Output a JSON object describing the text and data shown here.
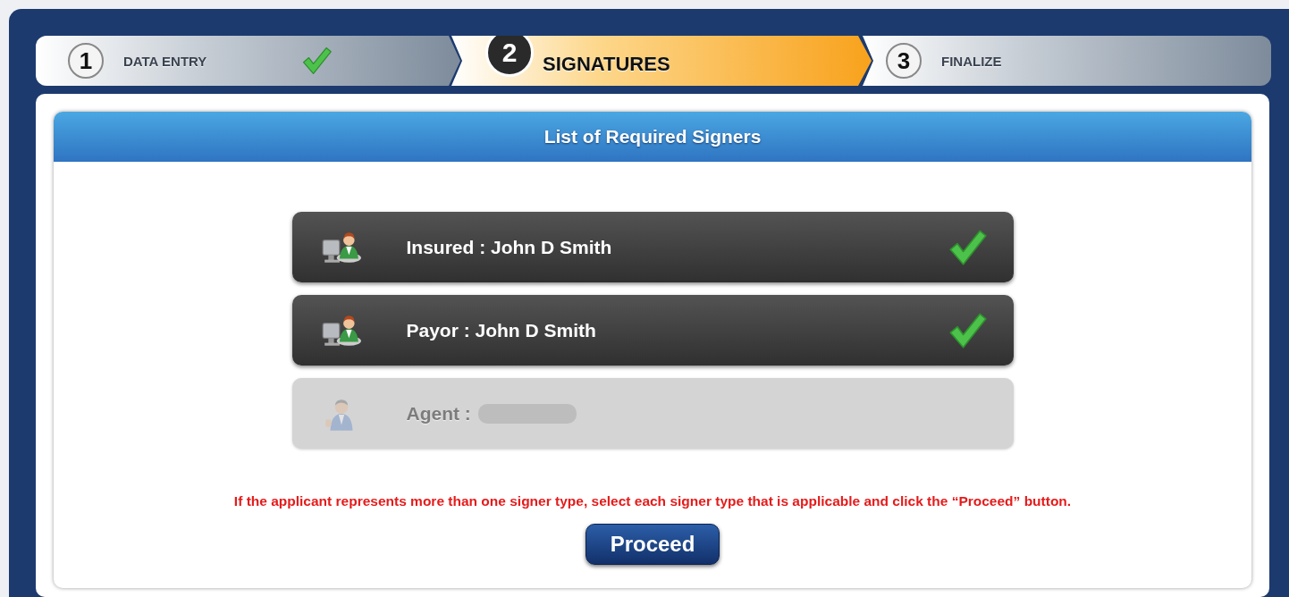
{
  "steps": [
    {
      "number": "1",
      "label": "DATA ENTRY",
      "kind": "done",
      "completed": true
    },
    {
      "number": "2",
      "label": "SIGNATURES",
      "kind": "current",
      "completed": false
    },
    {
      "number": "3",
      "label": "FINALIZE",
      "kind": "pending",
      "completed": false
    }
  ],
  "panel": {
    "title": "List of Required Signers"
  },
  "signers": [
    {
      "role": "Insured :",
      "name": "John D Smith",
      "kind": "user",
      "signed": true,
      "disabled": false,
      "redacted": false
    },
    {
      "role": "Payor :",
      "name": "John D Smith",
      "kind": "user",
      "signed": true,
      "disabled": false,
      "redacted": false
    },
    {
      "role": "Agent :",
      "kind": "agent",
      "signed": false,
      "disabled": true,
      "redacted": true
    }
  ],
  "notice": "If the applicant represents more than one signer type, select each signer type that is applicable and click the “Proceed” button.",
  "proceed_button": "Proceed"
}
